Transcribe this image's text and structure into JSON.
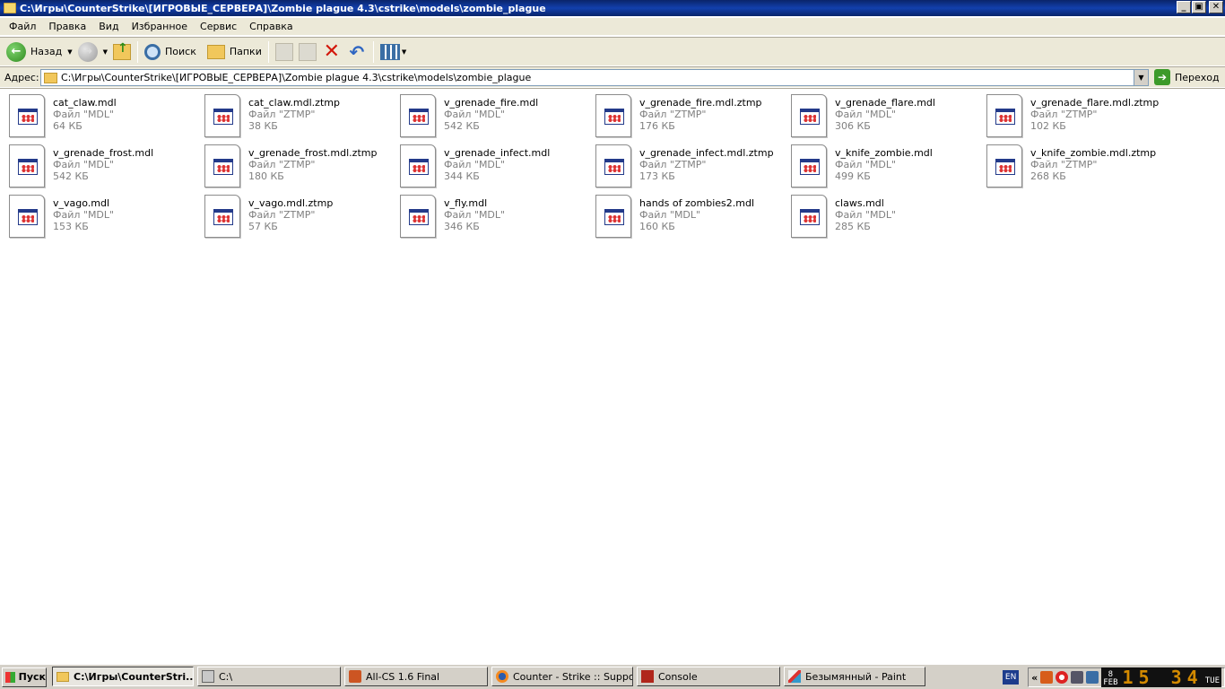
{
  "window": {
    "title": "C:\\Игры\\CounterStrike\\[ИГРОВЫЕ_СЕРВЕРА]\\Zombie plague 4.3\\cstrike\\models\\zombie_plague",
    "min_label": "_",
    "max_label": "▣",
    "close_label": "✕"
  },
  "menu": [
    "Файл",
    "Правка",
    "Вид",
    "Избранное",
    "Сервис",
    "Справка"
  ],
  "toolbar": {
    "back_label": "Назад",
    "search_label": "Поиск",
    "folders_label": "Папки"
  },
  "address": {
    "label": "Адрес:",
    "value": "C:\\Игры\\CounterStrike\\[ИГРОВЫЕ_СЕРВЕРА]\\Zombie plague 4.3\\cstrike\\models\\zombie_plague",
    "go_label": "Переход"
  },
  "files": [
    {
      "name": "cat_claw.mdl",
      "type": "Файл \"MDL\"",
      "size": "64 КБ"
    },
    {
      "name": "cat_claw.mdl.ztmp",
      "type": "Файл \"ZTMP\"",
      "size": "38 КБ"
    },
    {
      "name": "v_grenade_fire.mdl",
      "type": "Файл \"MDL\"",
      "size": "542 КБ"
    },
    {
      "name": "v_grenade_fire.mdl.ztmp",
      "type": "Файл \"ZTMP\"",
      "size": "176 КБ"
    },
    {
      "name": "v_grenade_flare.mdl",
      "type": "Файл \"MDL\"",
      "size": "306 КБ"
    },
    {
      "name": "v_grenade_flare.mdl.ztmp",
      "type": "Файл \"ZTMP\"",
      "size": "102 КБ"
    },
    {
      "name": "v_grenade_frost.mdl",
      "type": "Файл \"MDL\"",
      "size": "542 КБ"
    },
    {
      "name": "v_grenade_frost.mdl.ztmp",
      "type": "Файл \"ZTMP\"",
      "size": "180 КБ"
    },
    {
      "name": "v_grenade_infect.mdl",
      "type": "Файл \"MDL\"",
      "size": "344 КБ"
    },
    {
      "name": "v_grenade_infect.mdl.ztmp",
      "type": "Файл \"ZTMP\"",
      "size": "173 КБ"
    },
    {
      "name": "v_knife_zombie.mdl",
      "type": "Файл \"MDL\"",
      "size": "499 КБ"
    },
    {
      "name": "v_knife_zombie.mdl.ztmp",
      "type": "Файл \"ZTMP\"",
      "size": "268 КБ"
    },
    {
      "name": "v_vago.mdl",
      "type": "Файл \"MDL\"",
      "size": "153 КБ"
    },
    {
      "name": "v_vago.mdl.ztmp",
      "type": "Файл \"ZTMP\"",
      "size": "57 КБ"
    },
    {
      "name": "v_fly.mdl",
      "type": "Файл \"MDL\"",
      "size": "346 КБ"
    },
    {
      "name": "hands of zombies2.mdl",
      "type": "Файл \"MDL\"",
      "size": "160 КБ"
    },
    {
      "name": "claws.mdl",
      "type": "Файл \"MDL\"",
      "size": "285 КБ"
    }
  ],
  "taskbar": {
    "start_label": "Пуск",
    "tasks": [
      {
        "label": "C:\\Игры\\CounterStri...",
        "icon": "folder",
        "active": true
      },
      {
        "label": "C:\\",
        "icon": "pc",
        "active": false
      },
      {
        "label": "All-CS 1.6 Final",
        "icon": "hl",
        "active": false
      },
      {
        "label": "Counter - Strike :: Suppo...",
        "icon": "ff",
        "active": false
      },
      {
        "label": "Console",
        "icon": "con",
        "active": false
      },
      {
        "label": "Безымянный - Paint",
        "icon": "paint",
        "active": false
      }
    ],
    "lang": "EN",
    "tray_arrow": "«",
    "clock": {
      "day": "8",
      "month": "FEB",
      "time": "15 34",
      "dow": "TUE"
    }
  }
}
